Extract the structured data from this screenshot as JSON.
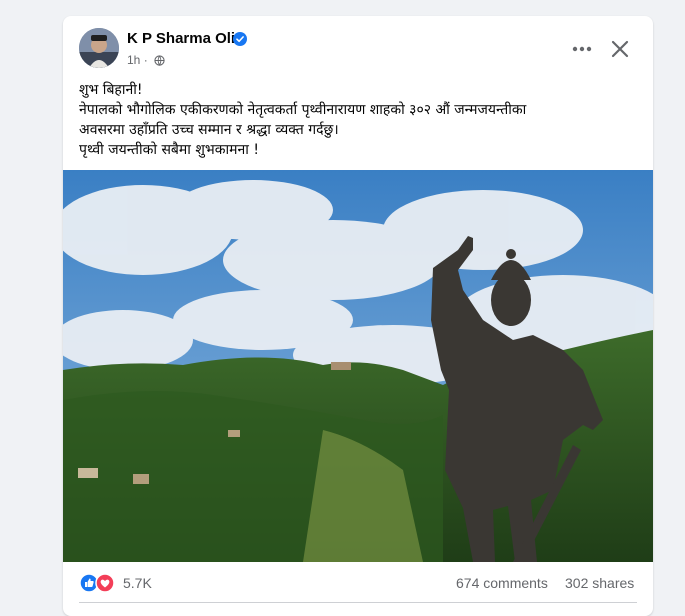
{
  "post": {
    "author": "K P Sharma Oli",
    "time": "1h",
    "text_lines": [
      "शुभ बिहानी!",
      "नेपालको भौगोलिक एकीकरणको नेतृत्वकर्ता पृथ्वीनारायण शाहको ३०२ औं जन्मजयन्तीका",
      "अवसरमा उहाँप्रति उच्च सम्मान र श्रद्धा व्यक्त गर्दछु।",
      "पृथ्वी जयन्तीको सबैमा शुभकामना !"
    ],
    "image_description_icon": "statue-photo"
  },
  "engagement": {
    "reactions": "5.7K",
    "comments": "674 comments",
    "shares": "302 shares"
  },
  "icons": {
    "verified": "verified-badge-icon",
    "more": "more-options-icon",
    "close": "close-icon",
    "like": "like-reaction-icon",
    "love": "love-reaction-icon"
  },
  "colors": {
    "accent": "#1877f2",
    "love": "#f33e58",
    "secondary_text": "#65676b"
  }
}
